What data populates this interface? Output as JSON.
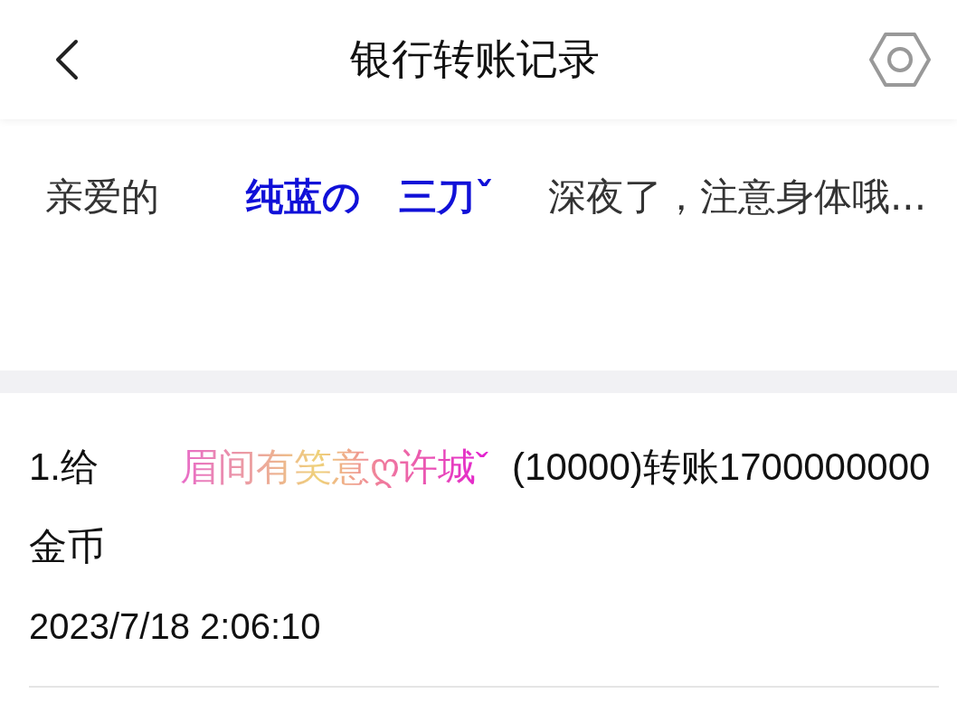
{
  "header": {
    "title": "银行转账记录"
  },
  "greeting": {
    "prefix": "亲爱的",
    "name": "纯蓝の　三刀ˇ",
    "suffix": "深夜了，注意身体哦..."
  },
  "records": [
    {
      "prefix": "1.给",
      "name": "眉间有笑意ღ许城ˇ",
      "detail": "(10000)转账1700000000金币",
      "time": "2023/7/18 2:06:10"
    }
  ]
}
